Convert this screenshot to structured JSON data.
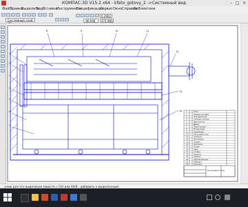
{
  "window": {
    "title": "КОМПАС-3D V15.2  x64 - kfeto_gotovy_2 ->Системный вид"
  },
  "menu": [
    "Файл",
    "Правка",
    "Выделить",
    "Вид",
    "Вставка",
    "Инструменты",
    "Спецификация",
    "Сервис",
    "Окно",
    "Справка",
    "Библиотеки"
  ],
  "toolbar": {
    "layer": "Системный слой (0)",
    "scale": "0.2902",
    "coord_x": "-90.946",
    "coord_y": "474.983"
  },
  "drawing": {
    "spec_rows": [
      "Печь",
      "Камера нагрева",
      "Под выкатной",
      "Газовая горелка",
      "Вентилятор",
      "Дверь",
      "Перегородка",
      "Воздуховод",
      "Термопара",
      "Рельсовый путь",
      "Тележка",
      "Футеровка",
      "Кладка",
      "Изоляция",
      "Опора",
      "Рама",
      "Стойка",
      "Крышка",
      "Привод",
      "Направляющая",
      "Лебедка",
      "Рольганг"
    ],
    "stamp_title": "Кольцевая печь",
    "numbers": [
      "1",
      "2",
      "3",
      "4",
      "5",
      "6",
      "7",
      "8",
      "9",
      "10",
      "11",
      "12",
      "13",
      "14",
      "15",
      "16",
      "17",
      "18",
      "19",
      "20",
      "21",
      "22"
    ]
  },
  "status": {
    "text": "...клик для его выделения (вместе с Ctrl или Shift - добавить к выделенным)"
  },
  "colors": {
    "drawing": "#0000c8",
    "canvas": "#ffffff",
    "taskbar": "#1c1f24"
  }
}
